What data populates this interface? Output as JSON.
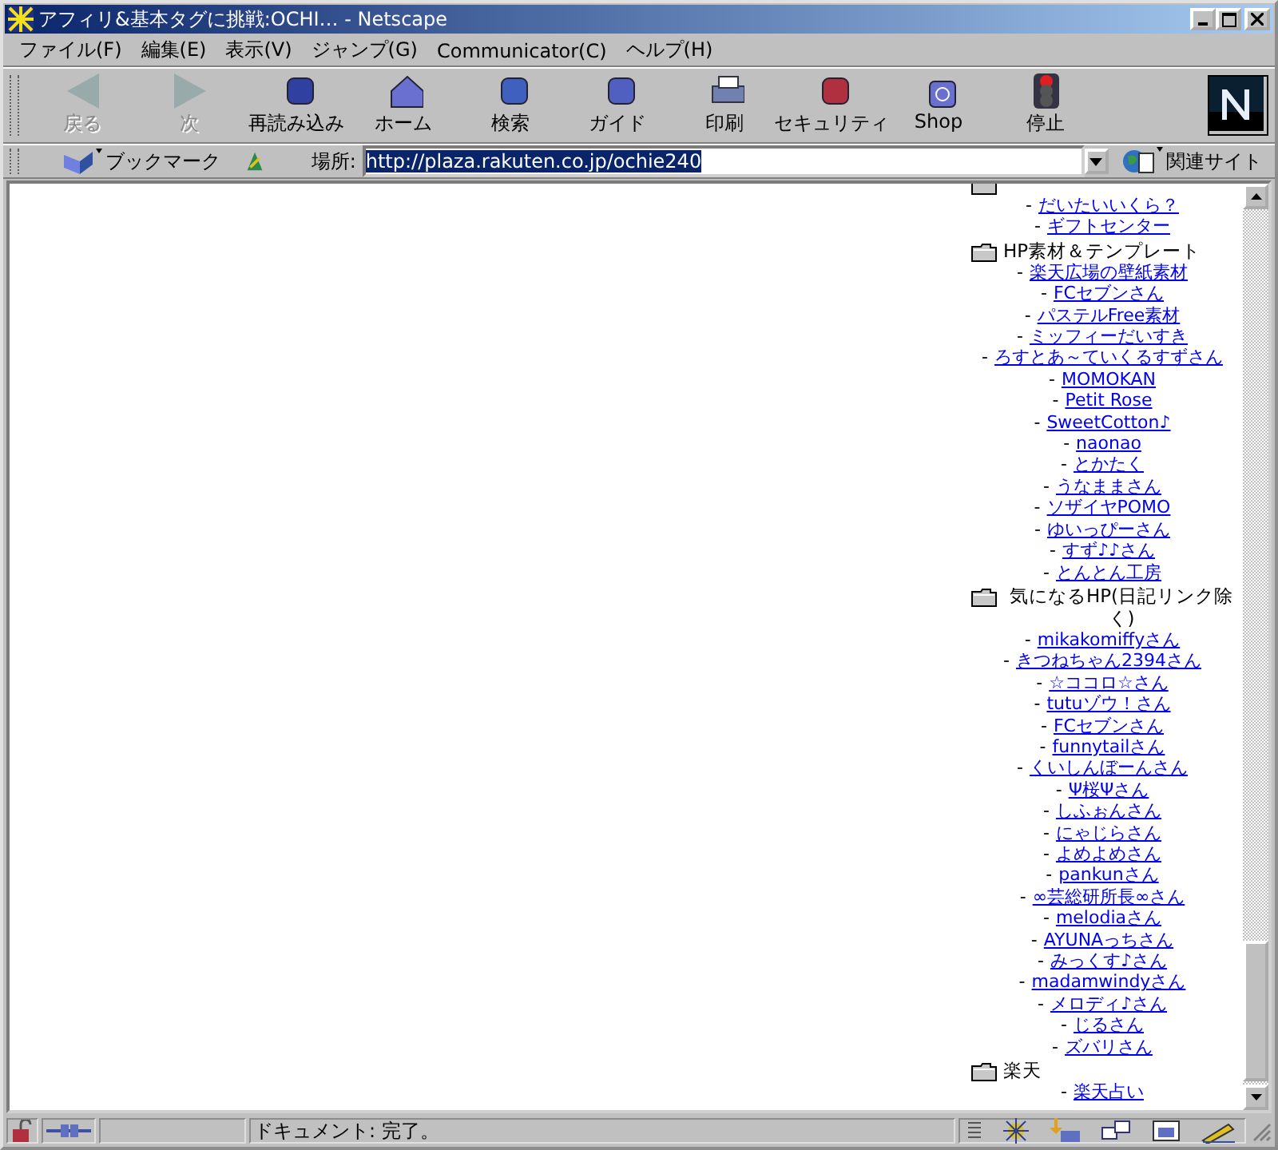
{
  "window": {
    "title": "アフィリ&基本タグに挑戦:OCHI… - Netscape"
  },
  "menu": [
    "ファイル(F)",
    "編集(E)",
    "表示(V)",
    "ジャンプ(G)",
    "Communicator(C)",
    "ヘルプ(H)"
  ],
  "toolbar": [
    {
      "label": "戻る",
      "disabled": true
    },
    {
      "label": "次",
      "disabled": true
    },
    {
      "label": "再読み込み",
      "disabled": false
    },
    {
      "label": "ホーム",
      "disabled": false
    },
    {
      "label": "検索",
      "disabled": false
    },
    {
      "label": "ガイド",
      "disabled": false
    },
    {
      "label": "印刷",
      "disabled": false
    },
    {
      "label": "セキュリティ",
      "disabled": false
    },
    {
      "label": "Shop",
      "disabled": false
    },
    {
      "label": "停止",
      "disabled": false
    }
  ],
  "location_bar": {
    "bookmarks": "ブックマーク",
    "label": "場所:",
    "url": "http://plaza.rakuten.co.jp/ochie240",
    "related": "関連サイト"
  },
  "content": {
    "sections": [
      {
        "links": [
          {
            "bullet": "-",
            "label": "だいたいいくら？"
          },
          {
            "bullet": "-",
            "label": "ギフトセンター"
          }
        ]
      },
      {
        "title": "HP素材＆テンプレート",
        "links": [
          {
            "bullet": "-",
            "label": "楽天広場の壁紙素材"
          },
          {
            "bullet": "-",
            "label": "FCセブンさん"
          },
          {
            "bullet": "-",
            "label": "パステルFree素材"
          },
          {
            "bullet": "-",
            "label": "ミッフィーだいすき"
          },
          {
            "bullet": "-",
            "label": "ろすとあ～ていくるすずさん"
          },
          {
            "bullet": "-",
            "label": "MOMOKAN"
          },
          {
            "bullet": "-",
            "label": "Petit Rose"
          },
          {
            "bullet": "-",
            "label": "SweetCotton♪"
          },
          {
            "bullet": "-",
            "label": "naonao"
          },
          {
            "bullet": "-",
            "label": "とかたく"
          },
          {
            "bullet": "-",
            "label": "うなままさん"
          },
          {
            "bullet": "-",
            "label": "ソザイヤPOMO"
          },
          {
            "bullet": "-",
            "label": "ゆいっぴーさん"
          },
          {
            "bullet": "-",
            "label": "すず♪♪さん"
          },
          {
            "bullet": "-",
            "label": "とんとん工房"
          }
        ]
      },
      {
        "title": "気になるHP(日記リンク除く)",
        "links": [
          {
            "bullet": "-",
            "label": "mikakomiffyさん"
          },
          {
            "bullet": "-",
            "label": "きつねちゃん2394さん"
          },
          {
            "bullet": "-",
            "label": "☆ココロ☆さん"
          },
          {
            "bullet": "-",
            "label": "tutuゾウ！さん"
          },
          {
            "bullet": "-",
            "label": "FCセブンさん"
          },
          {
            "bullet": "-",
            "label": "funnytailさん"
          },
          {
            "bullet": "-",
            "label": "くいしんぼーんさん"
          },
          {
            "bullet": "-",
            "label": "Ψ桜Ψさん"
          },
          {
            "bullet": "-",
            "label": "しふぉんさん"
          },
          {
            "bullet": "-",
            "label": "にゃじらさん"
          },
          {
            "bullet": "-",
            "label": "よめよめさん"
          },
          {
            "bullet": "-",
            "label": "pankunさん"
          },
          {
            "bullet": "-",
            "label": "∞芸総研所長∞さん"
          },
          {
            "bullet": "-",
            "label": "melodiaさん"
          },
          {
            "bullet": "-",
            "label": "AYUNAっちさん"
          },
          {
            "bullet": "-",
            "label": "みっくす♪さん"
          },
          {
            "bullet": "-",
            "label": "madamwindyさん"
          },
          {
            "bullet": "-",
            "label": "メロディ♪さん"
          },
          {
            "bullet": "-",
            "label": "じるさん"
          },
          {
            "bullet": "-",
            "label": "ズバリさん"
          }
        ]
      },
      {
        "title": "楽天",
        "links": [
          {
            "bullet": "-",
            "label": "楽天占い"
          }
        ]
      }
    ]
  },
  "status_bar": {
    "text": "ドキュメント: 完了。"
  }
}
